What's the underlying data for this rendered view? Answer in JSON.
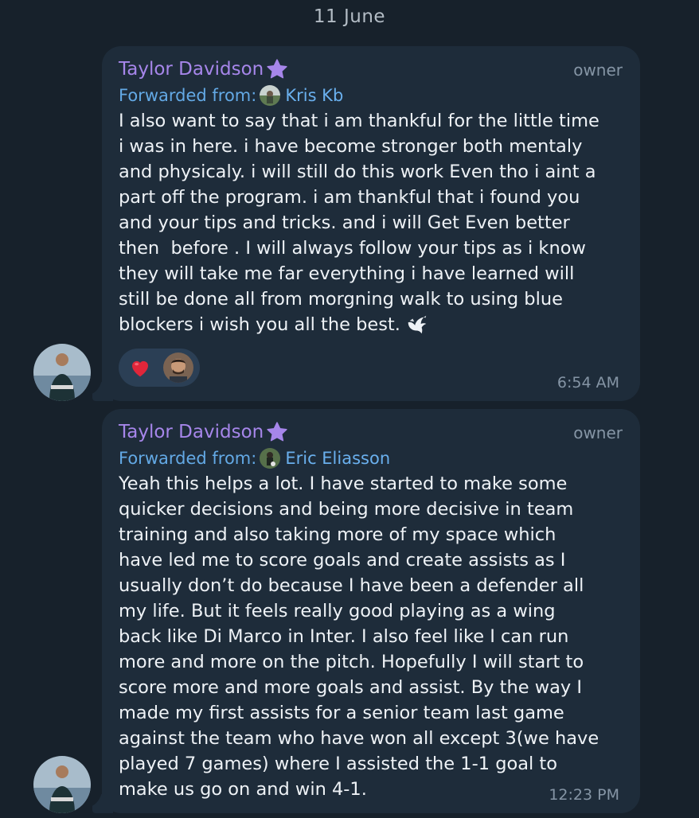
{
  "date_separator": "11 June",
  "messages": [
    {
      "sender": "Taylor Davidson",
      "role": "owner",
      "forwarded_label": "Forwarded from:",
      "forwarded_from": "Kris Kb",
      "text_lines": [
        "I also want to say that i am thankful for the little time",
        "i was in here. i have become stronger both mentaly",
        "and physicaly. i will still do this work Even tho i aint a",
        "part off the program. i am thankful that i found you",
        "and your tips and tricks. and i will Get Even better",
        "then  before . I will always follow your tips as i know",
        "they will take me far everything i have learned will",
        "still be done all from morgning walk to using blue",
        "blockers i wish you all the best."
      ],
      "emoji_icon": "dove-icon",
      "reaction_icon": "heart-icon",
      "time": "6:54 AM"
    },
    {
      "sender": "Taylor Davidson",
      "role": "owner",
      "forwarded_label": "Forwarded from:",
      "forwarded_from": "Eric Eliasson",
      "text_lines": [
        "Yeah this helps a lot. I have started to make some",
        "quicker decisions and being more decisive in team",
        "training and also taking more of my space which",
        "have led me to score goals and create assists as I",
        "usually don’t do because I have been a defender all",
        "my life. But it feels really good playing as a wing",
        "back like Di Marco in Inter. I also feel like I can run",
        "more and more on the pitch. Hopefully I will start to",
        "score more and more goals and assist. By the way I",
        "made my first assists for a senior team last game",
        "against the team who have won all except 3(we have",
        "played 7 games) where I assisted the 1-1 goal to",
        "make us go on and win 4-1."
      ],
      "time": "12:23 PM"
    }
  ],
  "colors": {
    "background": "#17212b",
    "bubble": "#1e2c3a",
    "sender": "#a686ea",
    "forward_link": "#6ab0ee",
    "reaction_bg": "#2b3f55",
    "heart": "#e0263a"
  }
}
